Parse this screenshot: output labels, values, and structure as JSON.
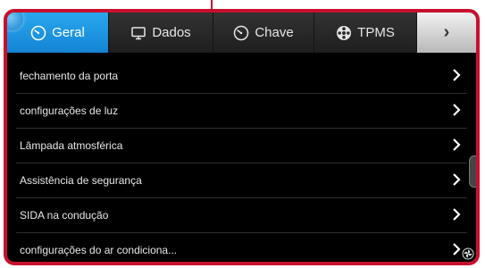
{
  "tabs": [
    {
      "label": "Geral",
      "icon": "dashboard-gauge-icon",
      "active": true
    },
    {
      "label": "Dados",
      "icon": "monitor-icon",
      "active": false
    },
    {
      "label": "Chave",
      "icon": "key-gauge-icon",
      "active": false
    },
    {
      "label": "TPMS",
      "icon": "tire-icon",
      "active": false
    }
  ],
  "next_tab_symbol": "›",
  "menu": {
    "items": [
      {
        "label": "fechamento da porta"
      },
      {
        "label": "configurações de luz"
      },
      {
        "label": "Lâmpada atmosférica"
      },
      {
        "label": "Assistência de segurança"
      },
      {
        "label": "SIDA na condução"
      },
      {
        "label": "configurações do ar condiciona..."
      }
    ]
  },
  "colors": {
    "frame_border": "#c8102e",
    "active_tab": "#1d95e2",
    "background": "#000000"
  }
}
